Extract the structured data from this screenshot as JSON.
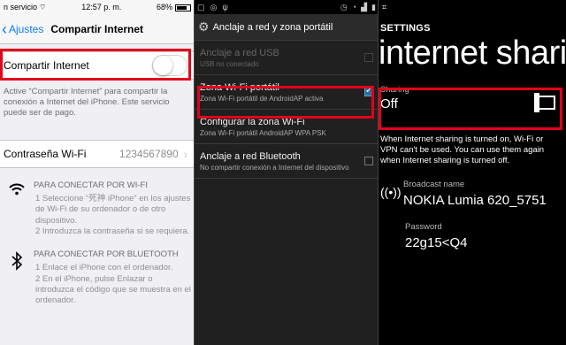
{
  "ios": {
    "status": {
      "carrier": "n servicio",
      "time": "12:57 p. m.",
      "battery": "68%"
    },
    "nav": {
      "back_label": "Ajustes",
      "title": "Compartir Internet"
    },
    "toggle_row": {
      "label": "Compartir Internet",
      "state": "off"
    },
    "description": "Active “Compartir Internet” para compartir la conexión a Internet del iPhone. Este servicio puede ser de pago.",
    "password_row": {
      "label": "Contraseña Wi-Fi",
      "value": "1234567890"
    },
    "wifi_section": {
      "heading": "PARA CONECTAR POR WI-FI",
      "steps": [
        "1 Seleccione “死神 iPhone” en los ajustes de Wi-Fi de su ordenador o de otro dispositivo.",
        "2 Introduzca la contraseña si se requiera."
      ]
    },
    "bluetooth_section": {
      "heading": "PARA CONECTAR POR BLUETOOTH",
      "steps": [
        "1 Enlace el iPhone con el ordenador.",
        "2 En el iPhone, pulse Enlazar o introduzca el código que se muestra en el ordenador."
      ]
    }
  },
  "android": {
    "header_title": "Anclaje a red y zona portátil",
    "rows": [
      {
        "title": "Anclaje a red USB",
        "subtitle": "USB no conectado",
        "checked": false,
        "disabled": true
      },
      {
        "title": "Zona Wi-Fi portátil",
        "subtitle": "Zona Wi-Fi portátil de AndroidAP activa",
        "checked": true,
        "disabled": false
      },
      {
        "title": "Configurar la zona Wi-Fi",
        "subtitle": "Zona Wi-Fi portátil AndroidAP WPA PSK",
        "checked": null,
        "disabled": false
      },
      {
        "title": "Anclaje a red Bluetooth",
        "subtitle": "No compartir conexión a Internet del dispositivo",
        "checked": false,
        "disabled": false
      }
    ]
  },
  "wp": {
    "section_label": "SETTINGS",
    "page_title": "internet sharing",
    "sharing": {
      "label": "Sharing",
      "value": "Off"
    },
    "info": "When Internet sharing is turned on, Wi-Fi or VPN can't be used. You can use them again when Internet sharing is turned off.",
    "broadcast": {
      "label": "Broadcast name",
      "value": "NOKIA Lumia 620_5751"
    },
    "password": {
      "label": "Password",
      "value": "22g15<Q4"
    }
  },
  "colors": {
    "highlight": "#e3001b",
    "ios_accent": "#0a7aff",
    "android_check": "#2a6f9a"
  }
}
